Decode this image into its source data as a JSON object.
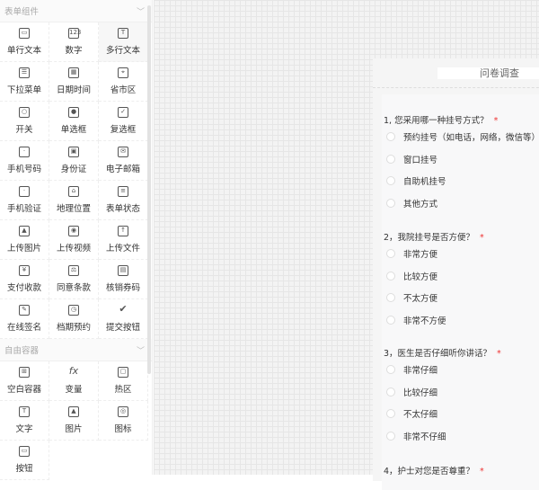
{
  "sidebar": {
    "sections": [
      {
        "title": "表单组件",
        "items": [
          {
            "label": "单行文本",
            "icon": "single-line-text-icon",
            "glyph": "▭"
          },
          {
            "label": "数字",
            "icon": "number-icon",
            "glyph": "123"
          },
          {
            "label": "多行文本",
            "icon": "multi-line-text-icon",
            "glyph": "T"
          },
          {
            "label": "下拉菜单",
            "icon": "dropdown-icon",
            "glyph": "☰"
          },
          {
            "label": "日期时间",
            "icon": "calendar-icon",
            "glyph": "▦"
          },
          {
            "label": "省市区",
            "icon": "map-region-icon",
            "glyph": "⌖"
          },
          {
            "label": "开关",
            "icon": "switch-icon",
            "glyph": "○"
          },
          {
            "label": "单选框",
            "icon": "radio-icon",
            "glyph": "●"
          },
          {
            "label": "复选框",
            "icon": "checkbox-icon",
            "glyph": "✓"
          },
          {
            "label": "手机号码",
            "icon": "mobile-icon",
            "glyph": "·"
          },
          {
            "label": "身份证",
            "icon": "id-card-icon",
            "glyph": "▣"
          },
          {
            "label": "电子邮箱",
            "icon": "email-icon",
            "glyph": "✉"
          },
          {
            "label": "手机验证",
            "icon": "mobile-verify-icon",
            "glyph": "·"
          },
          {
            "label": "地理位置",
            "icon": "location-icon",
            "glyph": "⌂"
          },
          {
            "label": "表单状态",
            "icon": "form-status-icon",
            "glyph": "≡"
          },
          {
            "label": "上传图片",
            "icon": "upload-image-icon",
            "glyph": "▲"
          },
          {
            "label": "上传视频",
            "icon": "upload-video-icon",
            "glyph": "◉"
          },
          {
            "label": "上传文件",
            "icon": "upload-file-icon",
            "glyph": "↑"
          },
          {
            "label": "支付收款",
            "icon": "payment-icon",
            "glyph": "¥"
          },
          {
            "label": "同意条款",
            "icon": "agree-terms-icon",
            "glyph": "⚖"
          },
          {
            "label": "核销券码",
            "icon": "coupon-code-icon",
            "glyph": "▤"
          },
          {
            "label": "在线签名",
            "icon": "signature-icon",
            "glyph": "✎"
          },
          {
            "label": "档期预约",
            "icon": "schedule-icon",
            "glyph": "◷"
          },
          {
            "label": "提交按钮",
            "icon": "submit-check-icon",
            "glyph": "✔"
          }
        ]
      },
      {
        "title": "自由容器",
        "items": [
          {
            "label": "空白容器",
            "icon": "blank-container-icon",
            "glyph": "⊞"
          },
          {
            "label": "变量",
            "icon": "variable-fx-icon",
            "glyph": "fx"
          },
          {
            "label": "热区",
            "icon": "hotspot-icon",
            "glyph": "▢"
          },
          {
            "label": "文字",
            "icon": "text-icon",
            "glyph": "T"
          },
          {
            "label": "图片",
            "icon": "image-icon",
            "glyph": "▲"
          },
          {
            "label": "图标",
            "icon": "icon-icon",
            "glyph": "◎"
          },
          {
            "label": "按钮",
            "icon": "button-icon",
            "glyph": "▭"
          }
        ]
      }
    ]
  },
  "form": {
    "title": "问卷调查",
    "questions": [
      {
        "text": "1, 您采用哪一种挂号方式？",
        "required": "*",
        "options": [
          "预约挂号（如电话，网络，微信等）",
          "窗口挂号",
          "自助机挂号",
          "其他方式"
        ]
      },
      {
        "text": "2，我院挂号是否方便？",
        "required": "*",
        "options": [
          "非常方便",
          "比较方便",
          "不太方便",
          "非常不方便"
        ]
      },
      {
        "text": "3，医生是否仔细听你讲话？",
        "required": "*",
        "options": [
          "非常仔细",
          "比较仔细",
          "不太仔细",
          "非常不仔细"
        ]
      },
      {
        "text": "4，护士对您是否尊重？",
        "required": "*",
        "options": []
      }
    ]
  }
}
